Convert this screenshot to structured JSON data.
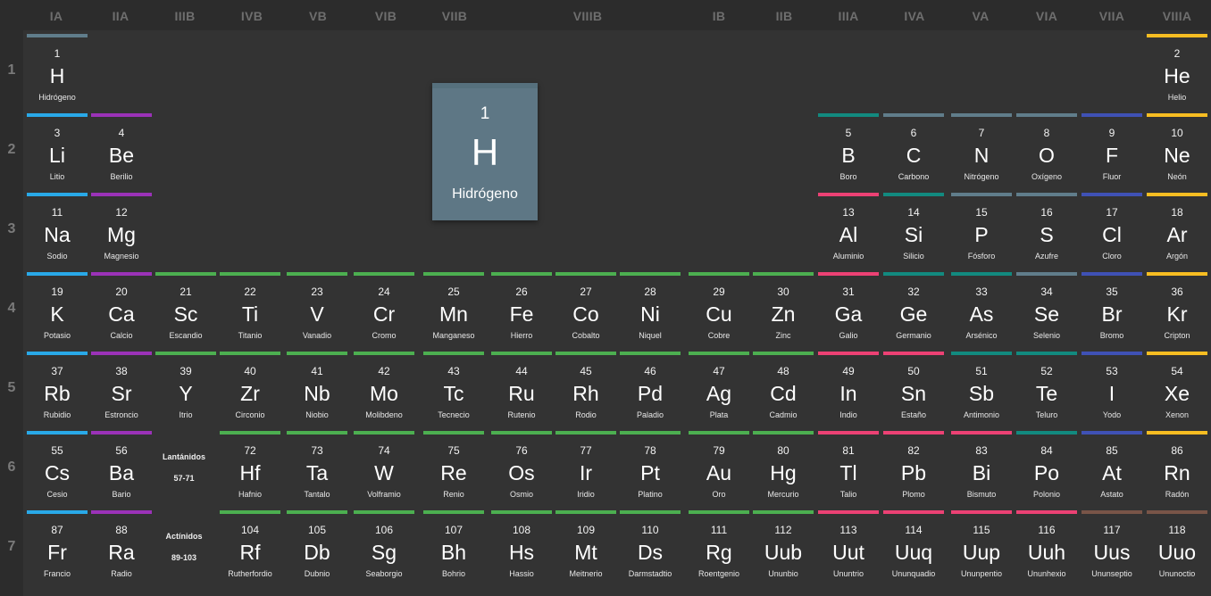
{
  "colors": {
    "alkali-metal": "#29a9e8",
    "alkaline-earth": "#9b32b8",
    "transition-metal": "#4caf50",
    "post-transition-metal": "#ec4174",
    "metalloid": "#128a7f",
    "nonmetal": "#607d8b",
    "halogen": "#3f51b5",
    "noble-gas": "#f7bd22",
    "unknown": "#795548",
    "hydrogen": "#607d8b"
  },
  "groups": [
    "IA",
    "IIA",
    "IIIB",
    "IVB",
    "VB",
    "VIB",
    "VIIB",
    "VIIIB",
    "IB",
    "IIB",
    "IIIA",
    "IVA",
    "VA",
    "VIA",
    "VIIA",
    "VIIIA"
  ],
  "periods": [
    "1",
    "2",
    "3",
    "4",
    "5",
    "6",
    "7"
  ],
  "placeholders": [
    {
      "title": "Lantánidos",
      "range": "57-71"
    },
    {
      "title": "Actínidos",
      "range": "89-103"
    }
  ],
  "detail": {
    "number": "1",
    "symbol": "H",
    "name": "Hidrógeno"
  },
  "elements": [
    {
      "n": "1",
      "s": "H",
      "name": "Hidrógeno",
      "cat": "hydrogen",
      "p": 1,
      "c": 1
    },
    {
      "n": "2",
      "s": "He",
      "name": "Helio",
      "cat": "noble-gas",
      "p": 1,
      "c": 18
    },
    {
      "n": "3",
      "s": "Li",
      "name": "Litio",
      "cat": "alkali-metal",
      "p": 2,
      "c": 1
    },
    {
      "n": "4",
      "s": "Be",
      "name": "Berilio",
      "cat": "alkaline-earth",
      "p": 2,
      "c": 2
    },
    {
      "n": "5",
      "s": "B",
      "name": "Boro",
      "cat": "metalloid",
      "p": 2,
      "c": 13
    },
    {
      "n": "6",
      "s": "C",
      "name": "Carbono",
      "cat": "nonmetal",
      "p": 2,
      "c": 14
    },
    {
      "n": "7",
      "s": "N",
      "name": "Nitrógeno",
      "cat": "nonmetal",
      "p": 2,
      "c": 15
    },
    {
      "n": "8",
      "s": "O",
      "name": "Oxígeno",
      "cat": "nonmetal",
      "p": 2,
      "c": 16
    },
    {
      "n": "9",
      "s": "F",
      "name": "Fluor",
      "cat": "halogen",
      "p": 2,
      "c": 17
    },
    {
      "n": "10",
      "s": "Ne",
      "name": "Neón",
      "cat": "noble-gas",
      "p": 2,
      "c": 18
    },
    {
      "n": "11",
      "s": "Na",
      "name": "Sodio",
      "cat": "alkali-metal",
      "p": 3,
      "c": 1
    },
    {
      "n": "12",
      "s": "Mg",
      "name": "Magnesio",
      "cat": "alkaline-earth",
      "p": 3,
      "c": 2
    },
    {
      "n": "13",
      "s": "Al",
      "name": "Aluminio",
      "cat": "post-transition-metal",
      "p": 3,
      "c": 13
    },
    {
      "n": "14",
      "s": "Si",
      "name": "Silicio",
      "cat": "metalloid",
      "p": 3,
      "c": 14
    },
    {
      "n": "15",
      "s": "P",
      "name": "Fósforo",
      "cat": "nonmetal",
      "p": 3,
      "c": 15
    },
    {
      "n": "16",
      "s": "S",
      "name": "Azufre",
      "cat": "nonmetal",
      "p": 3,
      "c": 16
    },
    {
      "n": "17",
      "s": "Cl",
      "name": "Cloro",
      "cat": "halogen",
      "p": 3,
      "c": 17
    },
    {
      "n": "18",
      "s": "Ar",
      "name": "Argón",
      "cat": "noble-gas",
      "p": 3,
      "c": 18
    },
    {
      "n": "19",
      "s": "K",
      "name": "Potasio",
      "cat": "alkali-metal",
      "p": 4,
      "c": 1
    },
    {
      "n": "20",
      "s": "Ca",
      "name": "Calcio",
      "cat": "alkaline-earth",
      "p": 4,
      "c": 2
    },
    {
      "n": "21",
      "s": "Sc",
      "name": "Escandio",
      "cat": "transition-metal",
      "p": 4,
      "c": 3
    },
    {
      "n": "22",
      "s": "Ti",
      "name": "Titanio",
      "cat": "transition-metal",
      "p": 4,
      "c": 4
    },
    {
      "n": "23",
      "s": "V",
      "name": "Vanadio",
      "cat": "transition-metal",
      "p": 4,
      "c": 5
    },
    {
      "n": "24",
      "s": "Cr",
      "name": "Cromo",
      "cat": "transition-metal",
      "p": 4,
      "c": 6
    },
    {
      "n": "25",
      "s": "Mn",
      "name": "Manganeso",
      "cat": "transition-metal",
      "p": 4,
      "c": 7
    },
    {
      "n": "26",
      "s": "Fe",
      "name": "Hierro",
      "cat": "transition-metal",
      "p": 4,
      "c": 8
    },
    {
      "n": "27",
      "s": "Co",
      "name": "Cobalto",
      "cat": "transition-metal",
      "p": 4,
      "c": 9
    },
    {
      "n": "28",
      "s": "Ni",
      "name": "Niquel",
      "cat": "transition-metal",
      "p": 4,
      "c": 10
    },
    {
      "n": "29",
      "s": "Cu",
      "name": "Cobre",
      "cat": "transition-metal",
      "p": 4,
      "c": 11
    },
    {
      "n": "30",
      "s": "Zn",
      "name": "Zinc",
      "cat": "transition-metal",
      "p": 4,
      "c": 12
    },
    {
      "n": "31",
      "s": "Ga",
      "name": "Galio",
      "cat": "post-transition-metal",
      "p": 4,
      "c": 13
    },
    {
      "n": "32",
      "s": "Ge",
      "name": "Germanio",
      "cat": "metalloid",
      "p": 4,
      "c": 14
    },
    {
      "n": "33",
      "s": "As",
      "name": "Arsénico",
      "cat": "metalloid",
      "p": 4,
      "c": 15
    },
    {
      "n": "34",
      "s": "Se",
      "name": "Selenio",
      "cat": "nonmetal",
      "p": 4,
      "c": 16
    },
    {
      "n": "35",
      "s": "Br",
      "name": "Bromo",
      "cat": "halogen",
      "p": 4,
      "c": 17
    },
    {
      "n": "36",
      "s": "Kr",
      "name": "Cripton",
      "cat": "noble-gas",
      "p": 4,
      "c": 18
    },
    {
      "n": "37",
      "s": "Rb",
      "name": "Rubidio",
      "cat": "alkali-metal",
      "p": 5,
      "c": 1
    },
    {
      "n": "38",
      "s": "Sr",
      "name": "Estroncio",
      "cat": "alkaline-earth",
      "p": 5,
      "c": 2
    },
    {
      "n": "39",
      "s": "Y",
      "name": "Itrio",
      "cat": "transition-metal",
      "p": 5,
      "c": 3
    },
    {
      "n": "40",
      "s": "Zr",
      "name": "Circonio",
      "cat": "transition-metal",
      "p": 5,
      "c": 4
    },
    {
      "n": "41",
      "s": "Nb",
      "name": "Niobio",
      "cat": "transition-metal",
      "p": 5,
      "c": 5
    },
    {
      "n": "42",
      "s": "Mo",
      "name": "Molibdeno",
      "cat": "transition-metal",
      "p": 5,
      "c": 6
    },
    {
      "n": "43",
      "s": "Tc",
      "name": "Tecnecio",
      "cat": "transition-metal",
      "p": 5,
      "c": 7
    },
    {
      "n": "44",
      "s": "Ru",
      "name": "Rutenio",
      "cat": "transition-metal",
      "p": 5,
      "c": 8
    },
    {
      "n": "45",
      "s": "Rh",
      "name": "Rodio",
      "cat": "transition-metal",
      "p": 5,
      "c": 9
    },
    {
      "n": "46",
      "s": "Pd",
      "name": "Paladio",
      "cat": "transition-metal",
      "p": 5,
      "c": 10
    },
    {
      "n": "47",
      "s": "Ag",
      "name": "Plata",
      "cat": "transition-metal",
      "p": 5,
      "c": 11
    },
    {
      "n": "48",
      "s": "Cd",
      "name": "Cadmio",
      "cat": "transition-metal",
      "p": 5,
      "c": 12
    },
    {
      "n": "49",
      "s": "In",
      "name": "Indio",
      "cat": "post-transition-metal",
      "p": 5,
      "c": 13
    },
    {
      "n": "50",
      "s": "Sn",
      "name": "Estaño",
      "cat": "post-transition-metal",
      "p": 5,
      "c": 14
    },
    {
      "n": "51",
      "s": "Sb",
      "name": "Antimonio",
      "cat": "metalloid",
      "p": 5,
      "c": 15
    },
    {
      "n": "52",
      "s": "Te",
      "name": "Teluro",
      "cat": "metalloid",
      "p": 5,
      "c": 16
    },
    {
      "n": "53",
      "s": "I",
      "name": "Yodo",
      "cat": "halogen",
      "p": 5,
      "c": 17
    },
    {
      "n": "54",
      "s": "Xe",
      "name": "Xenon",
      "cat": "noble-gas",
      "p": 5,
      "c": 18
    },
    {
      "n": "55",
      "s": "Cs",
      "name": "Cesio",
      "cat": "alkali-metal",
      "p": 6,
      "c": 1
    },
    {
      "n": "56",
      "s": "Ba",
      "name": "Bario",
      "cat": "alkaline-earth",
      "p": 6,
      "c": 2
    },
    {
      "n": "72",
      "s": "Hf",
      "name": "Hafnio",
      "cat": "transition-metal",
      "p": 6,
      "c": 4
    },
    {
      "n": "73",
      "s": "Ta",
      "name": "Tantalo",
      "cat": "transition-metal",
      "p": 6,
      "c": 5
    },
    {
      "n": "74",
      "s": "W",
      "name": "Volframio",
      "cat": "transition-metal",
      "p": 6,
      "c": 6
    },
    {
      "n": "75",
      "s": "Re",
      "name": "Renio",
      "cat": "transition-metal",
      "p": 6,
      "c": 7
    },
    {
      "n": "76",
      "s": "Os",
      "name": "Osmio",
      "cat": "transition-metal",
      "p": 6,
      "c": 8
    },
    {
      "n": "77",
      "s": "Ir",
      "name": "Iridio",
      "cat": "transition-metal",
      "p": 6,
      "c": 9
    },
    {
      "n": "78",
      "s": "Pt",
      "name": "Platino",
      "cat": "transition-metal",
      "p": 6,
      "c": 10
    },
    {
      "n": "79",
      "s": "Au",
      "name": "Oro",
      "cat": "transition-metal",
      "p": 6,
      "c": 11
    },
    {
      "n": "80",
      "s": "Hg",
      "name": "Mercurio",
      "cat": "transition-metal",
      "p": 6,
      "c": 12
    },
    {
      "n": "81",
      "s": "Tl",
      "name": "Talio",
      "cat": "post-transition-metal",
      "p": 6,
      "c": 13
    },
    {
      "n": "82",
      "s": "Pb",
      "name": "Plomo",
      "cat": "post-transition-metal",
      "p": 6,
      "c": 14
    },
    {
      "n": "83",
      "s": "Bi",
      "name": "Bismuto",
      "cat": "post-transition-metal",
      "p": 6,
      "c": 15
    },
    {
      "n": "84",
      "s": "Po",
      "name": "Polonio",
      "cat": "metalloid",
      "p": 6,
      "c": 16
    },
    {
      "n": "85",
      "s": "At",
      "name": "Astato",
      "cat": "halogen",
      "p": 6,
      "c": 17
    },
    {
      "n": "86",
      "s": "Rn",
      "name": "Radón",
      "cat": "noble-gas",
      "p": 6,
      "c": 18
    },
    {
      "n": "87",
      "s": "Fr",
      "name": "Francio",
      "cat": "alkali-metal",
      "p": 7,
      "c": 1
    },
    {
      "n": "88",
      "s": "Ra",
      "name": "Radio",
      "cat": "alkaline-earth",
      "p": 7,
      "c": 2
    },
    {
      "n": "104",
      "s": "Rf",
      "name": "Rutherfordio",
      "cat": "transition-metal",
      "p": 7,
      "c": 4
    },
    {
      "n": "105",
      "s": "Db",
      "name": "Dubnio",
      "cat": "transition-metal",
      "p": 7,
      "c": 5
    },
    {
      "n": "106",
      "s": "Sg",
      "name": "Seaborgio",
      "cat": "transition-metal",
      "p": 7,
      "c": 6
    },
    {
      "n": "107",
      "s": "Bh",
      "name": "Bohrio",
      "cat": "transition-metal",
      "p": 7,
      "c": 7
    },
    {
      "n": "108",
      "s": "Hs",
      "name": "Hassio",
      "cat": "transition-metal",
      "p": 7,
      "c": 8
    },
    {
      "n": "109",
      "s": "Mt",
      "name": "Meitnerio",
      "cat": "transition-metal",
      "p": 7,
      "c": 9
    },
    {
      "n": "110",
      "s": "Ds",
      "name": "Darmstadtio",
      "cat": "transition-metal",
      "p": 7,
      "c": 10
    },
    {
      "n": "111",
      "s": "Rg",
      "name": "Roentgenio",
      "cat": "transition-metal",
      "p": 7,
      "c": 11
    },
    {
      "n": "112",
      "s": "Uub",
      "name": "Ununbio",
      "cat": "transition-metal",
      "p": 7,
      "c": 12
    },
    {
      "n": "113",
      "s": "Uut",
      "name": "Ununtrio",
      "cat": "post-transition-metal",
      "p": 7,
      "c": 13
    },
    {
      "n": "114",
      "s": "Uuq",
      "name": "Ununquadio",
      "cat": "post-transition-metal",
      "p": 7,
      "c": 14
    },
    {
      "n": "115",
      "s": "Uup",
      "name": "Ununpentio",
      "cat": "post-transition-metal",
      "p": 7,
      "c": 15
    },
    {
      "n": "116",
      "s": "Uuh",
      "name": "Ununhexio",
      "cat": "post-transition-metal",
      "p": 7,
      "c": 16
    },
    {
      "n": "117",
      "s": "Uus",
      "name": "Ununseptio",
      "cat": "unknown",
      "p": 7,
      "c": 17
    },
    {
      "n": "118",
      "s": "Uuo",
      "name": "Ununoctio",
      "cat": "unknown",
      "p": 7,
      "c": 18
    }
  ]
}
